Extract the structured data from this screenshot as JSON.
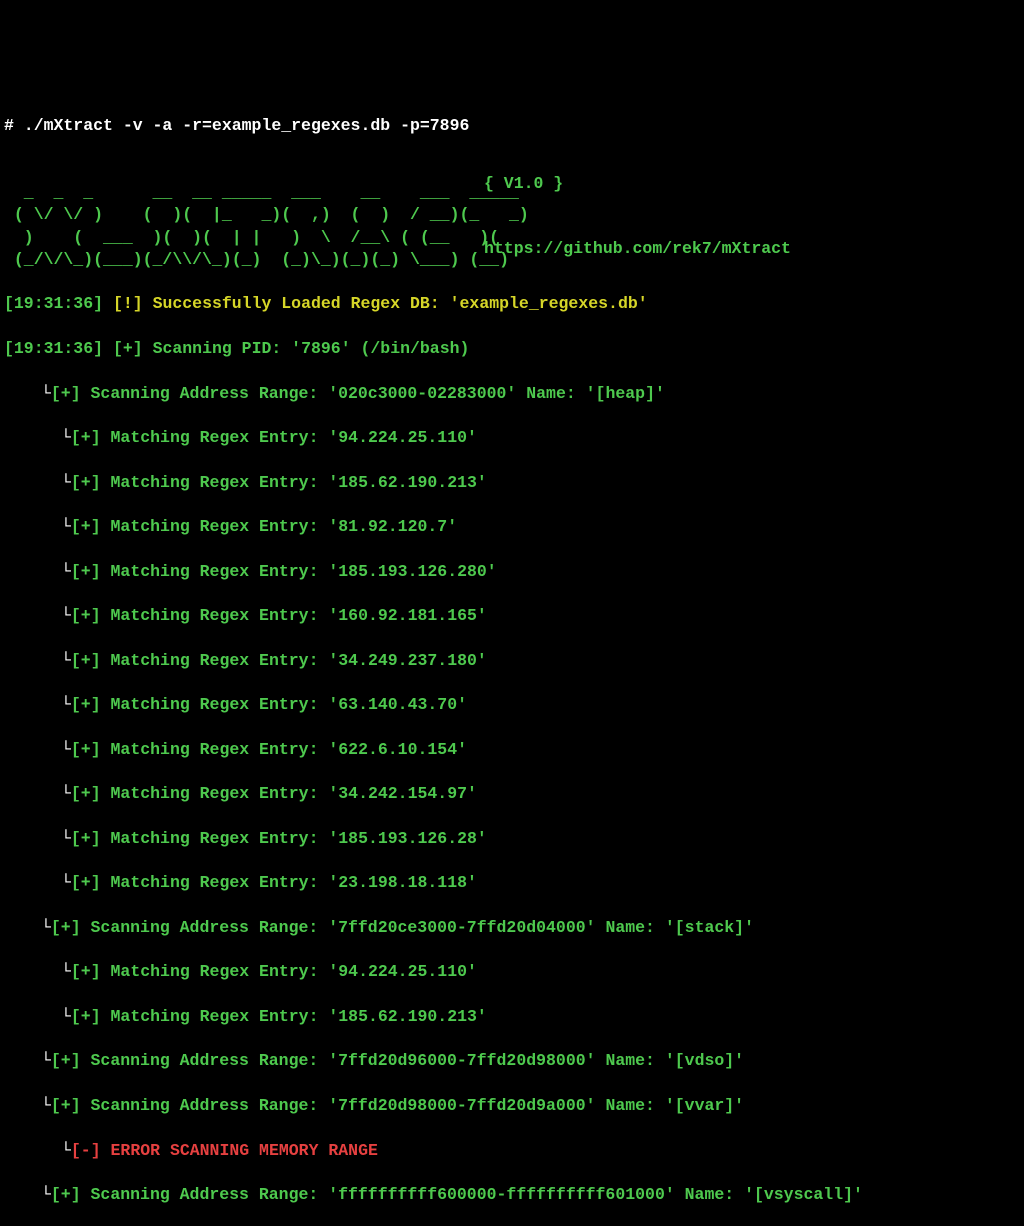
{
  "command": "# ./mXtract -v -a -r=example_regexes.db -p=7896",
  "version_tag": "{ V1.0 }",
  "ascii_art": "  _  _  _       __   __  _____  ___    __    ___  _____ \n ( \\/ \\/ )     (  ) (  )(_   _)(  ,)  (  )  / __)(_   _)\n  )    (  ___  )(   )(   ) (   )  \\  /__\\ ( (__   ) (  \n ( /\\/\\ )(___)(__) (__) (__) (_)\\_)(_)(_) \\___) (__) ",
  "github_url": "https://github.com/rek7/mXtract",
  "log": {
    "loaded": {
      "timestamp": "[19:31:36]",
      "tag": "[!]",
      "text": "Successfully Loaded Regex DB: 'example_regexes.db'"
    },
    "scanning_pid": {
      "timestamp": "[19:31:36]",
      "tag": "[+]",
      "text": "Scanning PID: '7896' (/bin/bash)"
    },
    "scan1": {
      "tag": "[+]",
      "label": "Scanning Address Range:",
      "range": "'020c3000-02283000'",
      "name_label": "Name:",
      "name": "'[heap]'"
    },
    "matches": [
      "'94.224.25.110'",
      "'185.62.190.213'",
      "'81.92.120.7'",
      "'185.193.126.280'",
      "'160.92.181.165'",
      "'34.249.237.180'",
      "'63.140.43.70'",
      "'622.6.10.154'",
      "'34.242.154.97'",
      "'185.193.126.28'",
      "'23.198.18.118'"
    ],
    "match_label": "Matching Regex Entry:",
    "match_tag": "[+]",
    "scan2": {
      "tag": "[+]",
      "label": "Scanning Address Range:",
      "range": "'7ffd20ce3000-7ffd20d04000'",
      "name_label": "Name:",
      "name": "'[stack]'"
    },
    "matches2": [
      "'94.224.25.110'",
      "'185.62.190.213'"
    ],
    "scan3": {
      "tag": "[+]",
      "label": "Scanning Address Range:",
      "range": "'7ffd20d96000-7ffd20d98000'",
      "name_label": "Name:",
      "name": "'[vdso]'"
    },
    "scan4": {
      "tag": "[+]",
      "label": "Scanning Address Range:",
      "range": "'7ffd20d98000-7ffd20d9a000'",
      "name_label": "Name:",
      "name": "'[vvar]'"
    },
    "error": {
      "tag": "[-]",
      "text": "ERROR SCANNING MEMORY RANGE"
    },
    "scan5": {
      "tag": "[+]",
      "label": "Scanning Address Range:",
      "range": "'ffffffffff600000-ffffffffff601000'",
      "name_label": "Name:",
      "name": "'[vsyscall]'"
    }
  },
  "tree_char1": "└",
  "tree_char2": "└"
}
